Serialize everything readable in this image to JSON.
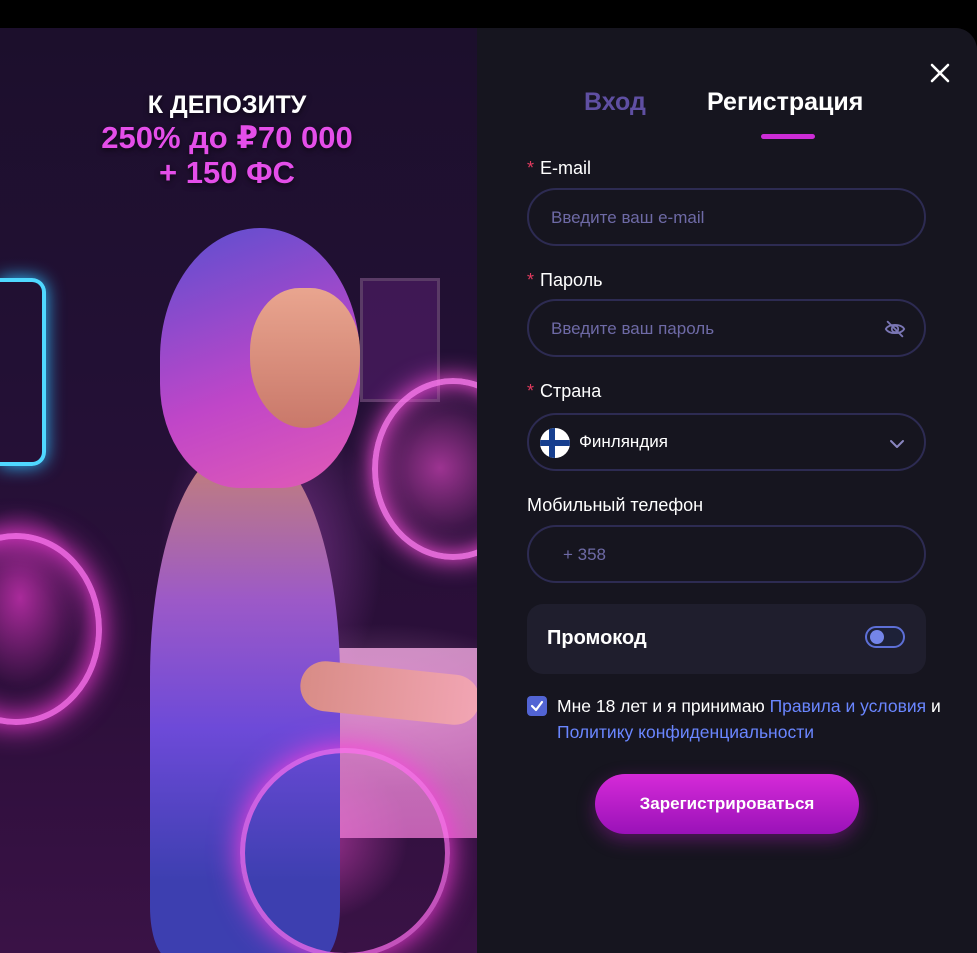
{
  "promo": {
    "title": "К ДЕПОЗИТУ",
    "line1": "250% до ₽70 000",
    "line2": "+ 150 ФС"
  },
  "tabs": {
    "login": "Вход",
    "register": "Регистрация",
    "active": "register"
  },
  "email": {
    "required_mark": "*",
    "label": "E-mail",
    "placeholder": "Введите ваш e-mail",
    "value": ""
  },
  "password": {
    "required_mark": "*",
    "label": "Пароль",
    "placeholder": "Введите ваш пароль",
    "value": "",
    "icon": "eye-off-icon"
  },
  "country": {
    "required_mark": "*",
    "label": "Страна",
    "value": "Финляндия",
    "flag": "finland-flag-icon"
  },
  "phone": {
    "label": "Мобильный телефон",
    "placeholder": "+ 358",
    "value": ""
  },
  "promocode": {
    "label": "Промокод",
    "enabled": false
  },
  "consent": {
    "checked": true,
    "text1": "Мне 18 лет и я принимаю ",
    "link1": "Правила и условия",
    "text2": " и ",
    "link2": "Политику конфиденциальности"
  },
  "submit_label": "Зарегистрироваться",
  "colors": {
    "accent": "#cc2cd6",
    "link": "#6a86ff",
    "panel_bg": "#16151f",
    "input_border": "#2d2b52",
    "promo_pink": "#e44ee9"
  }
}
